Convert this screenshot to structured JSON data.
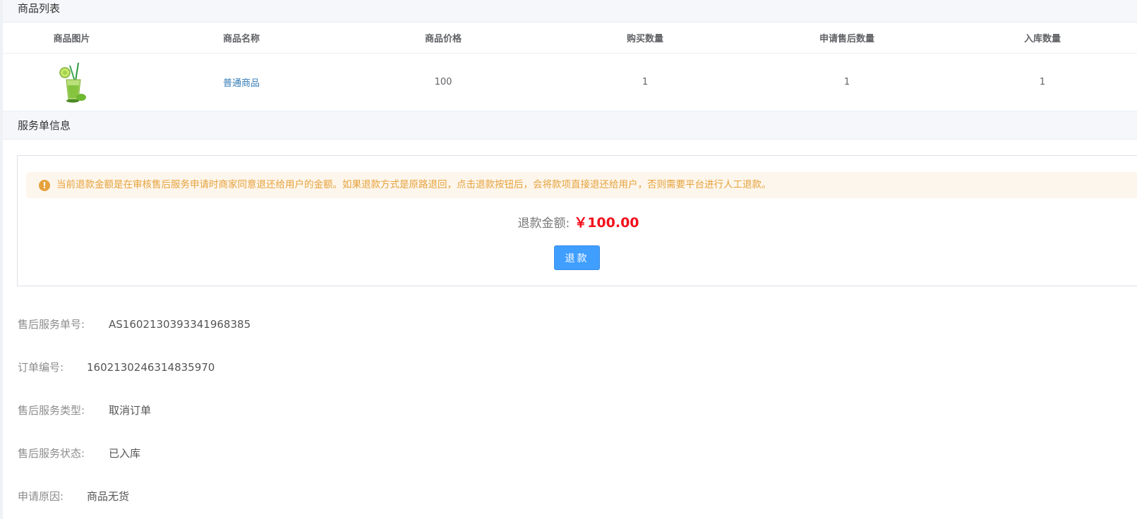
{
  "goods_section": {
    "title": "商品列表",
    "columns": [
      "商品图片",
      "商品名称",
      "商品价格",
      "购买数量",
      "申请售后数量",
      "入库数量"
    ],
    "rows": [
      {
        "image_icon": "cocktail-drink-icon",
        "name": "普通商品",
        "price": "100",
        "buy_qty": "1",
        "aftersale_qty": "1",
        "stock_in_qty": "1"
      }
    ]
  },
  "service_section": {
    "title": "服务单信息",
    "alert_text": "当前退款金额是在审核售后服务申请时商家同意退还给用户的金额。如果退款方式是原路退回，点击退款按钮后，会将款项直接退还给用户，否则需要平台进行人工退款。",
    "refund_label": "退款金额:",
    "refund_value": "￥100.00",
    "refund_button": "退款"
  },
  "info": {
    "service_no_label": "售后服务单号:",
    "service_no": "AS1602130393341968385",
    "order_no_label": "订单编号:",
    "order_no": "1602130246314835970",
    "service_type_label": "售后服务类型:",
    "service_type": "取消订单",
    "service_status_label": "售后服务状态:",
    "service_status": "已入库",
    "reason_label": "申请原因:",
    "reason": "商品无货"
  },
  "colors": {
    "accent": "#409eff",
    "warning": "#e6a23c",
    "price_red": "#f2101b",
    "link": "#337ab7"
  }
}
